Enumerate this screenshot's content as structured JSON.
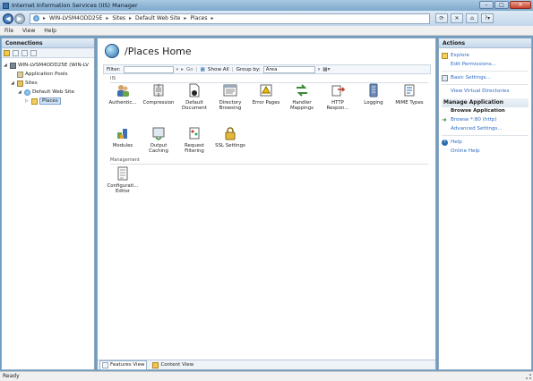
{
  "window": {
    "title": "Internet Information Services (IIS) Manager"
  },
  "address": {
    "crumbs": [
      "WIN-LVSM4ODD25E",
      "Sites",
      "Default Web Site",
      "Places"
    ]
  },
  "menu": [
    "File",
    "View",
    "Help"
  ],
  "connections": {
    "header": "Connections",
    "tree": [
      {
        "label": "WIN-LVSM4ODD25E (WIN-LV",
        "level": 0,
        "icon": "server-icon",
        "toggle": "◢"
      },
      {
        "label": "Application Pools",
        "level": 1,
        "icon": "app-pools-icon",
        "toggle": ""
      },
      {
        "label": "Sites",
        "level": 1,
        "icon": "sites-icon",
        "toggle": "◢"
      },
      {
        "label": "Default Web Site",
        "level": 2,
        "icon": "globe-icon",
        "toggle": "◢"
      },
      {
        "label": "Places",
        "level": 3,
        "icon": "folder-icon",
        "toggle": "▷"
      }
    ]
  },
  "center": {
    "title": "/Places Home",
    "filter_label": "Filter:",
    "go_label": "Go",
    "show_all_label": "Show All",
    "group_by_label": "Group by:",
    "group_by_value": "Area",
    "groups": [
      {
        "name": "IIS",
        "features": [
          {
            "label": "Authentic...",
            "icon": "authentication-icon"
          },
          {
            "label": "Compression",
            "icon": "compression-icon"
          },
          {
            "label": "Default Document",
            "icon": "default-document-icon"
          },
          {
            "label": "Directory Browsing",
            "icon": "directory-browsing-icon"
          },
          {
            "label": "Error Pages",
            "icon": "error-pages-icon"
          },
          {
            "label": "Handler Mappings",
            "icon": "handler-mappings-icon"
          },
          {
            "label": "HTTP Respon...",
            "icon": "http-response-icon"
          },
          {
            "label": "Logging",
            "icon": "logging-icon"
          },
          {
            "label": "MIME Types",
            "icon": "mime-types-icon"
          },
          {
            "label": "Modules",
            "icon": "modules-icon"
          },
          {
            "label": "Output Caching",
            "icon": "output-caching-icon"
          },
          {
            "label": "Request Filtering",
            "icon": "request-filtering-icon"
          },
          {
            "label": "SSL Settings",
            "icon": "ssl-settings-icon"
          }
        ]
      },
      {
        "name": "Management",
        "features": [
          {
            "label": "Configurati... Editor",
            "icon": "configuration-editor-icon"
          }
        ]
      }
    ],
    "tabs": [
      "Features View",
      "Content View"
    ]
  },
  "actions": {
    "header": "Actions",
    "items": [
      {
        "type": "link",
        "label": "Explore",
        "icon": "explore-icon"
      },
      {
        "type": "link",
        "label": "Edit Permissions...",
        "icon": ""
      },
      {
        "type": "divider"
      },
      {
        "type": "link",
        "label": "Basic Settings...",
        "icon": "settings-icon"
      },
      {
        "type": "divider"
      },
      {
        "type": "link",
        "label": "View Virtual Directories",
        "icon": ""
      },
      {
        "type": "section",
        "label": "Manage Application"
      },
      {
        "type": "subheader",
        "label": "Browse Application"
      },
      {
        "type": "link",
        "label": "Browse *:80 (http)",
        "icon": "browse-icon"
      },
      {
        "type": "link",
        "label": "Advanced Settings...",
        "icon": ""
      },
      {
        "type": "divider"
      },
      {
        "type": "link",
        "label": "Help",
        "icon": "help-icon"
      },
      {
        "type": "link",
        "label": "Online Help",
        "icon": ""
      }
    ]
  },
  "status": {
    "text": "Ready"
  }
}
